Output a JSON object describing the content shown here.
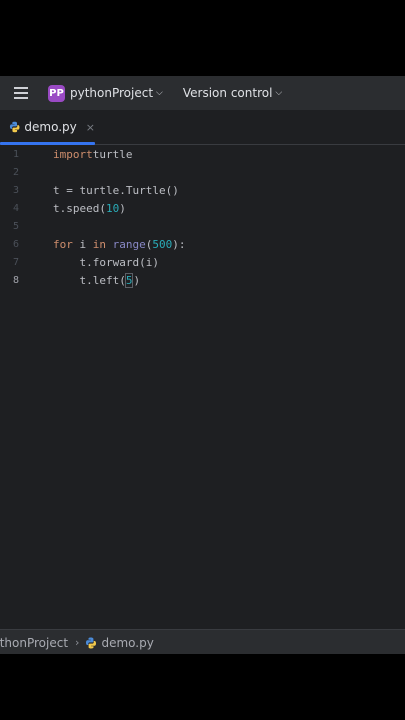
{
  "toolbar": {
    "project_badge": "PP",
    "project_name": "pythonProject",
    "version_control": "Version control"
  },
  "tab": {
    "file_name": "demo.py",
    "close": "×"
  },
  "editor": {
    "line_numbers": [
      "1",
      "2",
      "3",
      "4",
      "5",
      "6",
      "7",
      "8"
    ],
    "active_line": 8,
    "lines": [
      {
        "tokens": [
          [
            "kw",
            "import"
          ],
          [
            "",
            "turtle"
          ]
        ]
      },
      {
        "tokens": []
      },
      {
        "tokens": [
          [
            "",
            "t = turtle.Turtle()"
          ]
        ]
      },
      {
        "tokens": [
          [
            "",
            "t.speed("
          ],
          [
            "num",
            "10"
          ],
          [
            "",
            ")"
          ]
        ]
      },
      {
        "tokens": []
      },
      {
        "tokens": [
          [
            "kw",
            "for"
          ],
          [
            "",
            " i "
          ],
          [
            "kw",
            "in"
          ],
          [
            "",
            " "
          ],
          [
            "bi",
            "range"
          ],
          [
            "",
            "("
          ],
          [
            "num",
            "500"
          ],
          [
            "",
            "):"
          ]
        ]
      },
      {
        "tokens": [
          [
            "",
            "    t.forward(i)"
          ]
        ]
      },
      {
        "tokens": [
          [
            "",
            "    t.left("
          ],
          [
            "num",
            "5"
          ],
          [
            "",
            ")"
          ]
        ]
      }
    ]
  },
  "status": {
    "project": "pythonProject",
    "separator": "›",
    "file": "demo.py"
  },
  "colors": {
    "accent": "#3574f0",
    "keyword": "#cf8e6d",
    "number": "#2aacb8",
    "builtin": "#8888c6",
    "project_badge": "#9a4ac4"
  }
}
